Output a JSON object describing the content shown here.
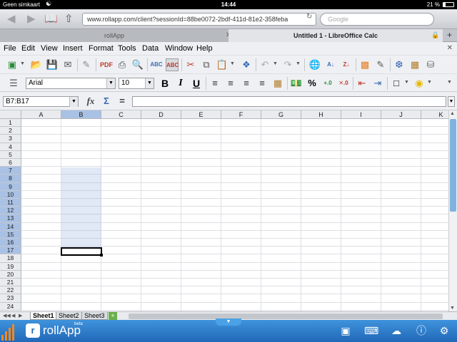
{
  "status_bar": {
    "carrier": "Geen simkaart",
    "time": "14:44",
    "battery": "21 %"
  },
  "browser": {
    "url": "www.rollapp.com/client?sessionId=88be0072-2bdf-411d-81e2-358feba",
    "search_placeholder": "Google",
    "tabs": [
      {
        "label": "rollApp"
      },
      {
        "label": "Untitled 1 - LibreOffice Calc"
      }
    ]
  },
  "menu": {
    "items": [
      "File",
      "Edit",
      "View",
      "Insert",
      "Format",
      "Tools",
      "Data",
      "Window",
      "Help"
    ]
  },
  "toolbar2": {
    "font_name": "Arial",
    "font_size": "10",
    "bold": "B",
    "italic": "I",
    "underline": "U",
    "percent": "%"
  },
  "formula_bar": {
    "name_box": "B7:B17",
    "function_wizard": "fx",
    "sum": "Σ",
    "equals": "=",
    "formula": ""
  },
  "grid": {
    "columns": [
      "A",
      "B",
      "C",
      "D",
      "E",
      "F",
      "G",
      "H",
      "I",
      "J",
      "K"
    ],
    "rows": [
      "1",
      "2",
      "3",
      "4",
      "5",
      "6",
      "7",
      "8",
      "9",
      "10",
      "11",
      "12",
      "13",
      "14",
      "15",
      "16",
      "17",
      "18",
      "19",
      "20",
      "21",
      "22",
      "23",
      "24"
    ],
    "selected_column": "B",
    "selected_rows": [
      "7",
      "8",
      "9",
      "10",
      "11",
      "12",
      "13",
      "14",
      "15",
      "16",
      "17"
    ],
    "active_cell": "B17"
  },
  "sheets": [
    {
      "label": "Sheet1",
      "active": true
    },
    {
      "label": "Sheet2"
    },
    {
      "label": "Sheet3"
    }
  ],
  "rollapp": {
    "brand": "rollApp",
    "beta": "beta"
  }
}
